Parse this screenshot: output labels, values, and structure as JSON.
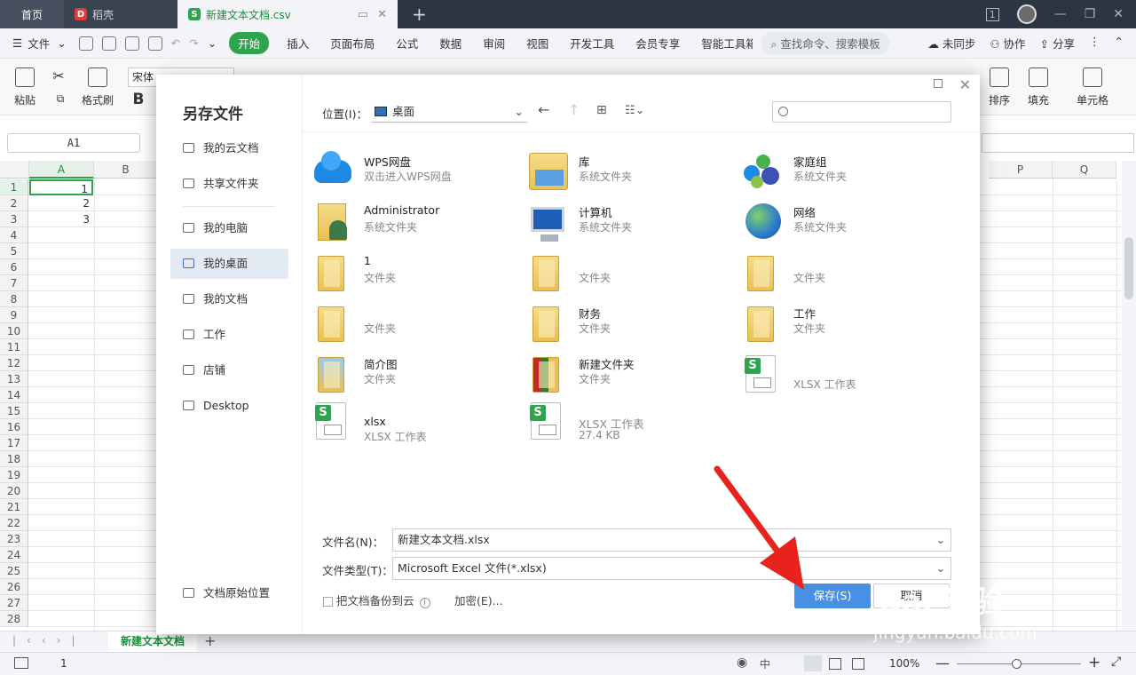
{
  "titlebar": {
    "tabs": [
      {
        "label": "首页"
      },
      {
        "label": "稻壳"
      },
      {
        "label": "新建文本文档.csv"
      }
    ],
    "page_num_icon": "1"
  },
  "menubar": {
    "file": "文件",
    "items": [
      "开始",
      "插入",
      "页面布局",
      "公式",
      "数据",
      "审阅",
      "视图",
      "开发工具",
      "会员专享",
      "智能工具箱"
    ],
    "search": "查找命令、搜索模板",
    "right": [
      "未同步",
      "协作",
      "分享"
    ]
  },
  "ribbon": {
    "paste": "粘贴",
    "format_painter": "格式刷",
    "font": "宋体",
    "bold": "B",
    "sort": "排序",
    "fill": "填充",
    "cell": "单元格"
  },
  "namebox": "A1",
  "grid": {
    "columns": [
      "A",
      "B",
      "P",
      "Q"
    ],
    "rows": [
      "1",
      "2",
      "3",
      "4",
      "5",
      "6",
      "7",
      "8",
      "9",
      "10",
      "11",
      "12",
      "13",
      "14",
      "15",
      "16",
      "17",
      "18",
      "19",
      "20",
      "21",
      "22",
      "23",
      "24",
      "25",
      "26",
      "27",
      "28"
    ],
    "cells": [
      "1",
      "2",
      "3"
    ]
  },
  "sheet": {
    "tab": "新建文本文档"
  },
  "status": {
    "page": "1",
    "zoom": "100%"
  },
  "dialog": {
    "title": "另存文件",
    "sidebar": [
      "我的云文档",
      "共享文件夹",
      "我的电脑",
      "我的桌面",
      "我的文档",
      "工作",
      "店铺",
      "Desktop"
    ],
    "sidebar_bottom": "文档原始位置",
    "location_label": "位置(I)：",
    "location_value": "桌面",
    "files": [
      {
        "name": "WPS网盘",
        "sub": "双击进入WPS网盘",
        "icon": "cloud-icon"
      },
      {
        "name": "库",
        "sub": "系统文件夹",
        "icon": "library-icon"
      },
      {
        "name": "家庭组",
        "sub": "系统文件夹",
        "icon": "homegroup-icon"
      },
      {
        "name": "Administrator",
        "sub": "系统文件夹",
        "icon": "user-folder-icon"
      },
      {
        "name": "计算机",
        "sub": "系统文件夹",
        "icon": "computer-icon"
      },
      {
        "name": "网络",
        "sub": "系统文件夹",
        "icon": "network-icon"
      },
      {
        "name": "1",
        "sub": "文件夹",
        "icon": "folder-icon"
      },
      {
        "name": "",
        "sub": "文件夹",
        "icon": "folder-icon"
      },
      {
        "name": "",
        "sub": "文件夹",
        "icon": "folder-icon"
      },
      {
        "name": "",
        "sub": "文件夹",
        "icon": "folder-icon"
      },
      {
        "name": "财务",
        "sub": "文件夹",
        "icon": "folder-icon"
      },
      {
        "name": "工作",
        "sub": "文件夹",
        "icon": "folder-icon"
      },
      {
        "name": "简介图",
        "sub": "文件夹",
        "icon": "folder-icon"
      },
      {
        "name": "新建文件夹",
        "sub": "文件夹",
        "icon": "folder-icon"
      },
      {
        "name": "",
        "sub": "XLSX 工作表",
        "icon": "xlsx-icon"
      },
      {
        "name": "xlsx",
        "sub": "XLSX 工作表",
        "icon": "xlsx-icon"
      },
      {
        "name": "XLSX 工作表",
        "sub": "27.4 KB",
        "icon": "xlsx-icon"
      }
    ],
    "filename_label": "文件名(N)：",
    "filename_value": "新建文本文档.xlsx",
    "filetype_label": "文件类型(T)：",
    "filetype_value": "Microsoft Excel 文件(*.xlsx)",
    "backup_label": "把文档备份到云",
    "encrypt_label": "加密(E)...",
    "save_label": "保存(S)",
    "cancel_label": "取消"
  },
  "watermark": {
    "brand": "Bai 经验",
    "url": "jingyan.baidu.com"
  },
  "colors": {
    "accent_green": "#2fa44f",
    "save_blue": "#4a90e2",
    "arrow_red": "#e8231d"
  }
}
